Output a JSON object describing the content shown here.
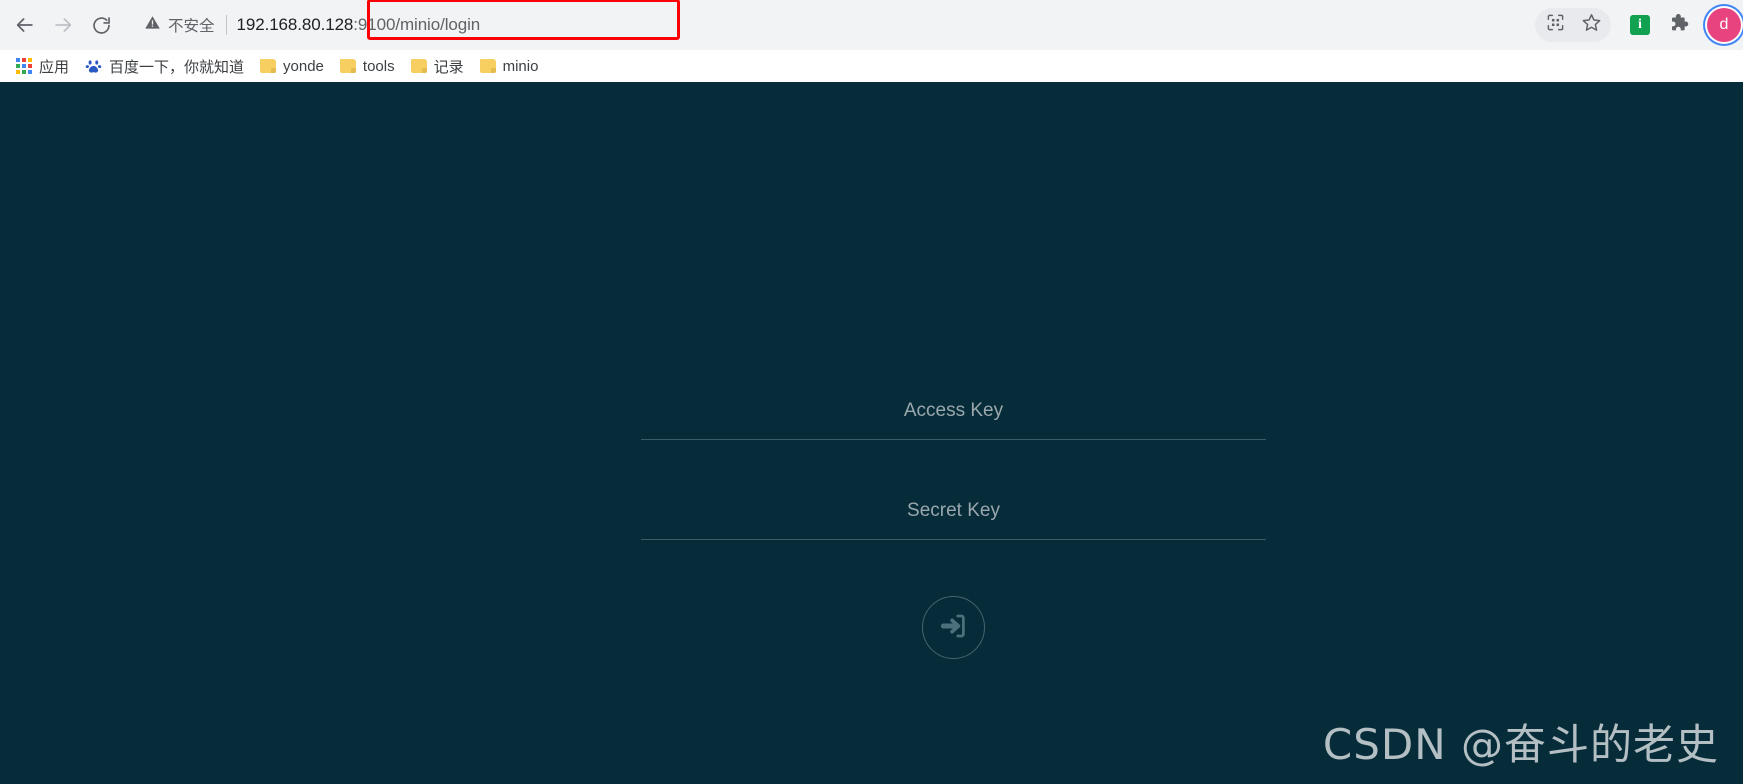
{
  "browser": {
    "nav": {
      "back": "back-arrow",
      "forward": "forward-arrow",
      "reload": "reload"
    },
    "omnibox": {
      "security_icon": "warning-triangle-icon",
      "security_label": "不安全",
      "url_host": "192.168.80.128",
      "url_rest": ":9100/minio/login",
      "url_full": "192.168.80.128:9100/minio/login",
      "highlight_color": "#fb0007"
    },
    "toolbar_right": {
      "qr_icon": "qr-code-icon",
      "bookmark_icon": "star-icon",
      "extension_badge_letter": "i",
      "extension_badge_color": "#12a150",
      "extensions_icon": "puzzle-piece-icon",
      "profile_initial": "d",
      "profile_color": "#e8437e"
    },
    "bookmarks": [
      {
        "label": "应用",
        "icon": "apps-grid-icon"
      },
      {
        "label": "百度一下，你就知道",
        "icon": "baidu-paw-icon"
      },
      {
        "label": "yonde",
        "icon": "folder-icon"
      },
      {
        "label": "tools",
        "icon": "folder-icon"
      },
      {
        "label": "记录",
        "icon": "folder-icon"
      },
      {
        "label": "minio",
        "icon": "folder-icon"
      }
    ]
  },
  "page": {
    "background_color": "#062c3a",
    "login": {
      "access_key_placeholder": "Access Key",
      "access_key_value": "",
      "secret_key_placeholder": "Secret Key",
      "secret_key_value": "",
      "submit_icon": "sign-in-arrow-icon"
    },
    "watermark": "CSDN @奋斗的老史"
  }
}
